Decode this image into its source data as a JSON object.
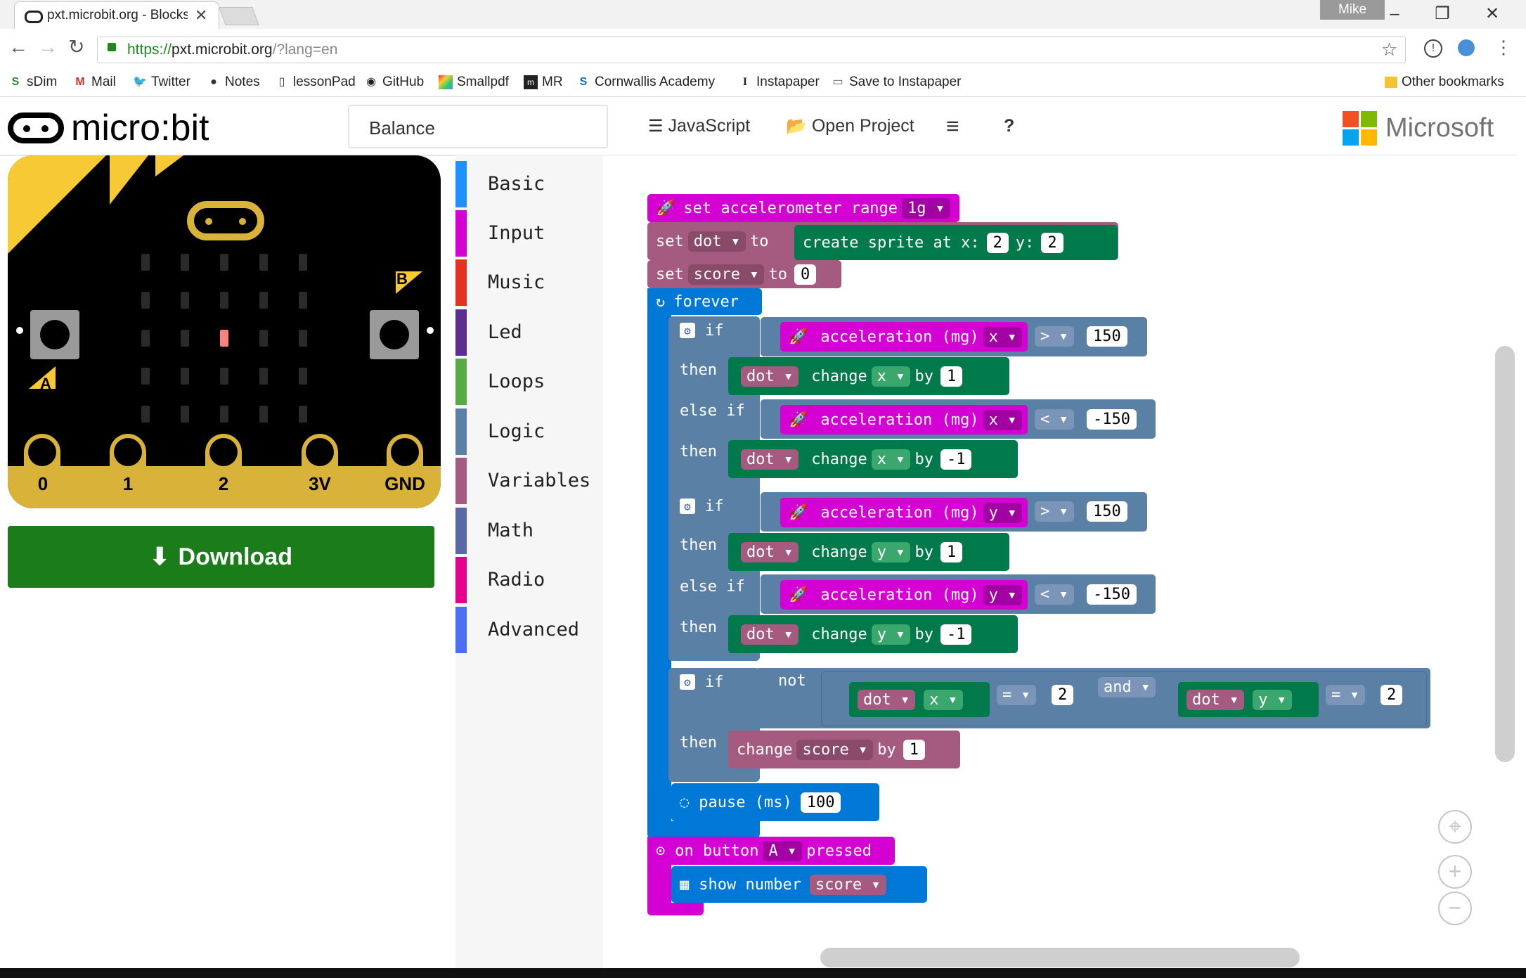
{
  "browser": {
    "tab_title": "pxt.microbit.org - Blocks",
    "url_secure": "https://",
    "url_host": "pxt.microbit.org",
    "url_path": "/?lang=en",
    "profile_name": "Mike",
    "bookmarks": [
      {
        "label": "sDim",
        "icon": "s-icon"
      },
      {
        "label": "Mail",
        "icon": "gmail-icon"
      },
      {
        "label": "Twitter",
        "icon": "twitter-icon"
      },
      {
        "label": "Notes",
        "icon": "apple-icon"
      },
      {
        "label": "lessonPad",
        "icon": "phone-icon"
      },
      {
        "label": "GitHub",
        "icon": "github-icon"
      },
      {
        "label": "Smallpdf",
        "icon": "smallpdf-icon"
      },
      {
        "label": "MR",
        "icon": "mr-icon"
      },
      {
        "label": "Cornwallis Academy",
        "icon": "sharepoint-icon"
      },
      {
        "label": "Instapaper",
        "icon": "instapaper-icon"
      },
      {
        "label": "Save to Instapaper",
        "icon": "page-icon"
      },
      {
        "label": "Other bookmarks",
        "icon": "folder-icon"
      }
    ]
  },
  "app": {
    "logo_text": "micro:bit",
    "project_name": "Balance",
    "javascript_label": "JavaScript",
    "open_project_label": "Open Project",
    "menu_label": "≡",
    "help_label": "?",
    "brand": "Microsoft"
  },
  "simulator": {
    "button_a": "A",
    "button_b": "B",
    "pins": [
      "0",
      "1",
      "2",
      "3V",
      "GND"
    ],
    "lit_led": {
      "row": 2,
      "col": 2
    },
    "download_label": "Download"
  },
  "toolbox": [
    {
      "label": "Basic",
      "color": "#1e90ff"
    },
    {
      "label": "Input",
      "color": "#d400d4"
    },
    {
      "label": "Music",
      "color": "#e63022"
    },
    {
      "label": "Led",
      "color": "#5c2d91"
    },
    {
      "label": "Loops",
      "color": "#58ab41"
    },
    {
      "label": "Logic",
      "color": "#5b80a5"
    },
    {
      "label": "Variables",
      "color": "#a55b80"
    },
    {
      "label": "Math",
      "color": "#5c68a6"
    },
    {
      "label": "Radio",
      "color": "#e3008c"
    },
    {
      "label": "Advanced",
      "color": "#4c6ef5"
    }
  ],
  "blocks": {
    "set_range": {
      "text": "set accelerometer range",
      "value": "1g"
    },
    "set_dot": {
      "set": "set",
      "var": "dot",
      "to": "to",
      "create": "create sprite at x:",
      "x": "2",
      "y_label": "y:",
      "y": "2"
    },
    "set_score": {
      "set": "set",
      "var": "score",
      "to": "to",
      "value": "0"
    },
    "forever": "forever",
    "if1": {
      "if": "if",
      "accel": "acceleration (mg)",
      "axis": "x",
      "op": ">",
      "value": "150",
      "then": "then",
      "dot": "dot",
      "change": "change",
      "by": "by",
      "amount": "1"
    },
    "elseif1": {
      "else_if": "else if",
      "accel": "acceleration (mg)",
      "axis": "x",
      "op": "<",
      "value": "-150",
      "then": "then",
      "dot": "dot",
      "change": "change",
      "by": "by",
      "amount": "-1"
    },
    "if2": {
      "if": "if",
      "accel": "acceleration (mg)",
      "axis": "y",
      "op": ">",
      "value": "150",
      "then": "then",
      "dot": "dot",
      "change": "change",
      "by": "by",
      "amount": "1"
    },
    "elseif2": {
      "else_if": "else if",
      "accel": "acceleration (mg)",
      "axis": "y",
      "op": "<",
      "value": "-150",
      "then": "then",
      "dot": "dot",
      "change": "change",
      "by": "by",
      "amount": "-1"
    },
    "if3": {
      "if": "if",
      "not": "not",
      "dot1": "dot",
      "axis1": "x",
      "eq1": "=",
      "v1": "2",
      "and": "and",
      "dot2": "dot",
      "axis2": "y",
      "eq2": "=",
      "v2": "2",
      "then": "then",
      "change": "change",
      "var": "score",
      "by": "by",
      "amount": "1"
    },
    "pause": {
      "label": "pause (ms)",
      "value": "100"
    },
    "on_button": {
      "on": "on button",
      "btn": "A",
      "pressed": "pressed"
    },
    "show_number": {
      "label": "show number",
      "var": "score"
    }
  }
}
